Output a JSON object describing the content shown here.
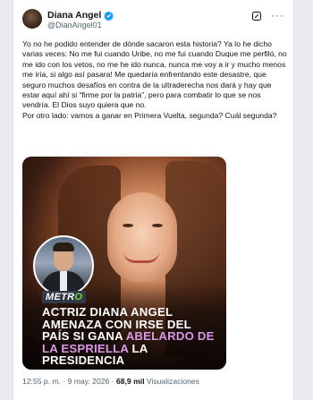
{
  "author": {
    "display_name": "Diana Angel",
    "handle": "@DianAngel01"
  },
  "tweet": {
    "paragraphs": [
      "Yo no he podido entender de dónde sacaron esta historia? Ya lo he dicho varias veces: No me fui cuando Uribe, no me fui cuando Duque me perfiló, no me ido con los vetos, no me he ido nunca, nunca me voy a ir y mucho menos me iría, si algo así pasara! Me quedaría enfrentando este desastre, que seguro muchos desafíos en contra de la ultraderecha nos dará y hay que estar aquí ahí si “firme por la patria”, pero para combatir lo que se nos vendría. El Dios suyo quiera que no.",
      "Por otro lado: vamos a ganar en Primera Vuelta, segunda? Cuál segunda?"
    ]
  },
  "media": {
    "logo": {
      "prefix": "METR",
      "accent": "O"
    },
    "headline": {
      "part1": "ACTRIZ DIANA ANGEL AMENAZA CON IRSE DEL PAÍS SI GANA ",
      "accent": "ABELARDO DE LA ESPRIELLA",
      "part2": " LA PRESIDENCIA"
    }
  },
  "meta": {
    "time": "12:55 p. m.",
    "separator": " · ",
    "date": "9 may. 2026",
    "views_count": "68,9 mil",
    "views_label": " Visualizaciones"
  },
  "colors": {
    "verified": "#1d9bf0",
    "headline_accent": "#d89ae6",
    "logo_accent": "#7ad13b"
  },
  "icons": [
    "verified-badge-icon",
    "grok-icon",
    "more-options-icon"
  ]
}
